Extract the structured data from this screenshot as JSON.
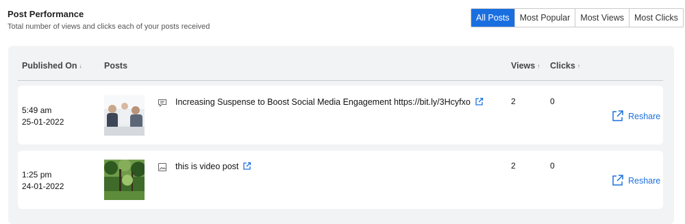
{
  "header": {
    "title": "Post Performance",
    "subtitle": "Total number of views and clicks each of your posts received"
  },
  "filters": [
    "All Posts",
    "Most Popular",
    "Most Views",
    "Most Clicks"
  ],
  "active_filter": "All Posts",
  "table": {
    "columns": {
      "published": "Published On",
      "published_sort": "↓",
      "posts": "Posts",
      "views": "Views",
      "views_sort": "↑",
      "clicks": "Clicks",
      "clicks_sort": "↑"
    },
    "rows": [
      {
        "time": "5:49 am",
        "date": "25-01-2022",
        "post_type_icon": "text-post-icon",
        "text": "Increasing Suspense to Boost Social Media Engagement https://bit.ly/3Hcyfxo",
        "views": "2",
        "clicks": "0",
        "action": "Reshare"
      },
      {
        "time": "1:25 pm",
        "date": "24-01-2022",
        "post_type_icon": "image-post-icon",
        "text": "this is video post",
        "views": "2",
        "clicks": "0",
        "action": "Reshare"
      }
    ]
  },
  "colors": {
    "accent": "#1a6fe0",
    "panel_bg": "#f2f3f5"
  }
}
